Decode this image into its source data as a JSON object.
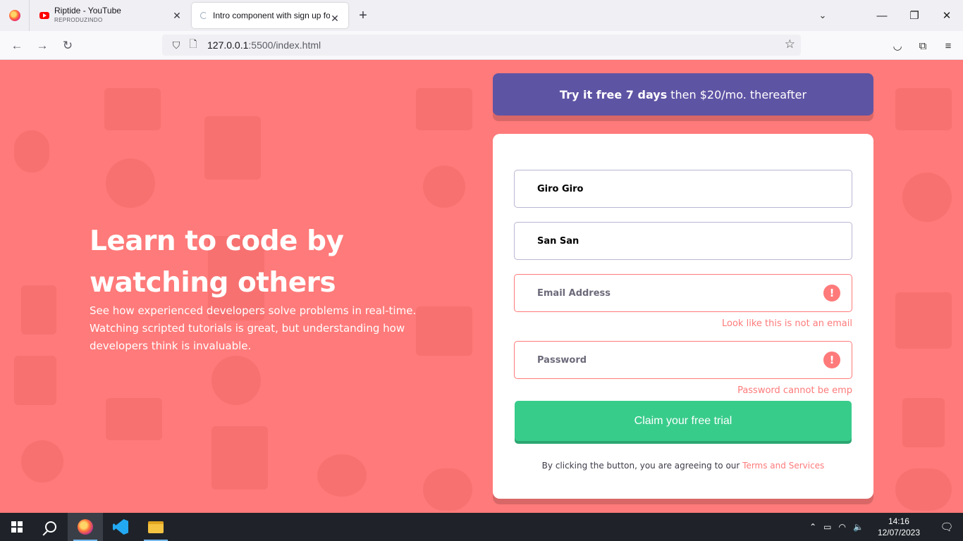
{
  "browser": {
    "tabs": [
      {
        "title": "Riptide - YouTube",
        "subtitle": "REPRODUZINDO"
      },
      {
        "title": "Intro component with sign up form"
      }
    ],
    "url_host": "127.0.0.1",
    "url_path": ":5500/index.html"
  },
  "hero": {
    "title": "Learn to code by watching others",
    "text": "See how experienced developers solve problems in real-time. Watching scripted tutorials is great, but understanding how developers think is invaluable."
  },
  "promo": {
    "bold": "Try it free 7 days",
    "rest": "then $20/mo. thereafter"
  },
  "form": {
    "first_name_value": "Giro Giro",
    "last_name_value": "San San",
    "email_placeholder": "Email Address",
    "email_error": "Look like this is not an email",
    "password_placeholder": "Password",
    "password_error": "Password cannot be emp",
    "submit_label": "Claim your free trial",
    "terms_text": "By clicking the button, you are agreeing to our",
    "terms_link": "Terms and Services"
  },
  "taskbar": {
    "time": "14:16",
    "date": "12/07/2023"
  },
  "colors": {
    "background": "#ff7a7a",
    "promo": "#5e54a4",
    "button": "#38cc8b",
    "error": "#ff7a7a"
  }
}
